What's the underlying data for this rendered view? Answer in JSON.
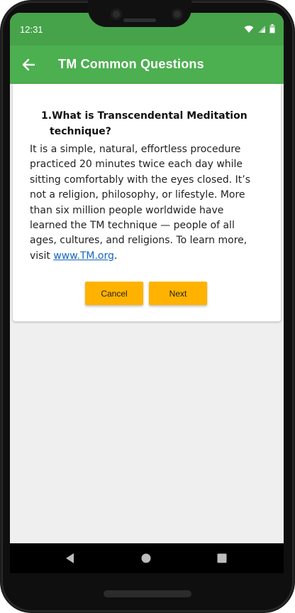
{
  "status_bar": {
    "time": "12:31"
  },
  "app_bar": {
    "title": "TM Common Questions"
  },
  "question": {
    "number": "1.",
    "title_line1": "What is Transcendental Meditation",
    "title_line2": "technique?",
    "answer_text": "It is a simple, natural, effortless procedure practiced 20 minutes twice each day while sitting comfortably with the eyes closed. It’s not a religion, philosophy, or lifestyle. More than six million people worldwide have learned the TM technique — people of all ages, cultures, and religions. To learn more, visit ",
    "link_text": "www.TM.org",
    "answer_end": "."
  },
  "buttons": {
    "cancel": "Cancel",
    "next": "Next"
  },
  "colors": {
    "status_bar": "#46a34a",
    "app_bar": "#4caf50",
    "button": "#ffb300",
    "link": "#1565c0"
  }
}
